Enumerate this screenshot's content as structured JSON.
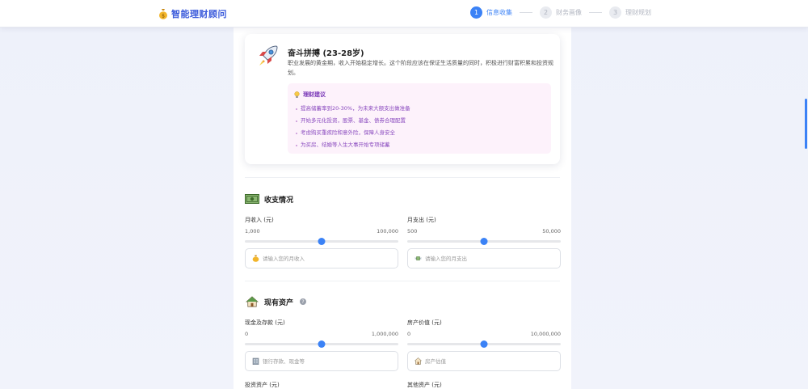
{
  "app": {
    "title": "智能理财顾问",
    "brand_icon": "money-bag-icon"
  },
  "steps": [
    {
      "number": "1",
      "label": "信息收集",
      "state": "active"
    },
    {
      "number": "2",
      "label": "财务画像",
      "state": "inactive"
    },
    {
      "number": "3",
      "label": "理财规划",
      "state": "inactive"
    }
  ],
  "stage": {
    "icon": "rocket-icon",
    "title": "奋斗拼搏 (23-28岁)",
    "description": "职业发展的黄金期，收入开始稳定增长。这个阶段应该在保证生活质量的同时，积极进行财富积累和投资规划。",
    "advice": {
      "title": "理财建议",
      "icon": "lightbulb-icon",
      "items": [
        "提高储蓄率到20-30%，为未来大额支出做准备",
        "开始多元化投资，股票、基金、债券合理配置",
        "考虑购买重疾险和意外险，保障人身安全",
        "为买房、结婚等人生大事开始专项储蓄"
      ]
    }
  },
  "income_expense": {
    "title": "收支情况",
    "icon": "cash-icon",
    "income": {
      "label": "月收入 (元)",
      "min": "1,000",
      "max": "100,000",
      "slider_value": 0.5,
      "placeholder": "请输入您的月收入",
      "icon": "money-bag-icon"
    },
    "expense": {
      "label": "月支出 (元)",
      "min": "500",
      "max": "50,000",
      "slider_value": 0.5,
      "placeholder": "请输入您的月支出",
      "icon": "money-wings-icon"
    }
  },
  "assets": {
    "title": "现有资产",
    "icon": "house-icon",
    "help_icon": "question-icon",
    "help_glyph": "?",
    "cash": {
      "label": "现金及存款 (元)",
      "min": "0",
      "max": "1,000,000",
      "slider_value": 0.5,
      "placeholder": "银行存款、现金等",
      "icon": "bank-icon"
    },
    "property": {
      "label": "房产价值 (元)",
      "min": "0",
      "max": "10,000,000",
      "slider_value": 0.5,
      "placeholder": "房产估值",
      "icon": "house-icon"
    },
    "investment": {
      "label": "投资资产 (元)"
    },
    "other": {
      "label": "其他资产 (元)"
    }
  },
  "colors": {
    "accent": "#3b82f6",
    "brand": "#3b5bdb",
    "advice_text": "#8a4bbf",
    "advice_bg": "#fdf2fb"
  }
}
